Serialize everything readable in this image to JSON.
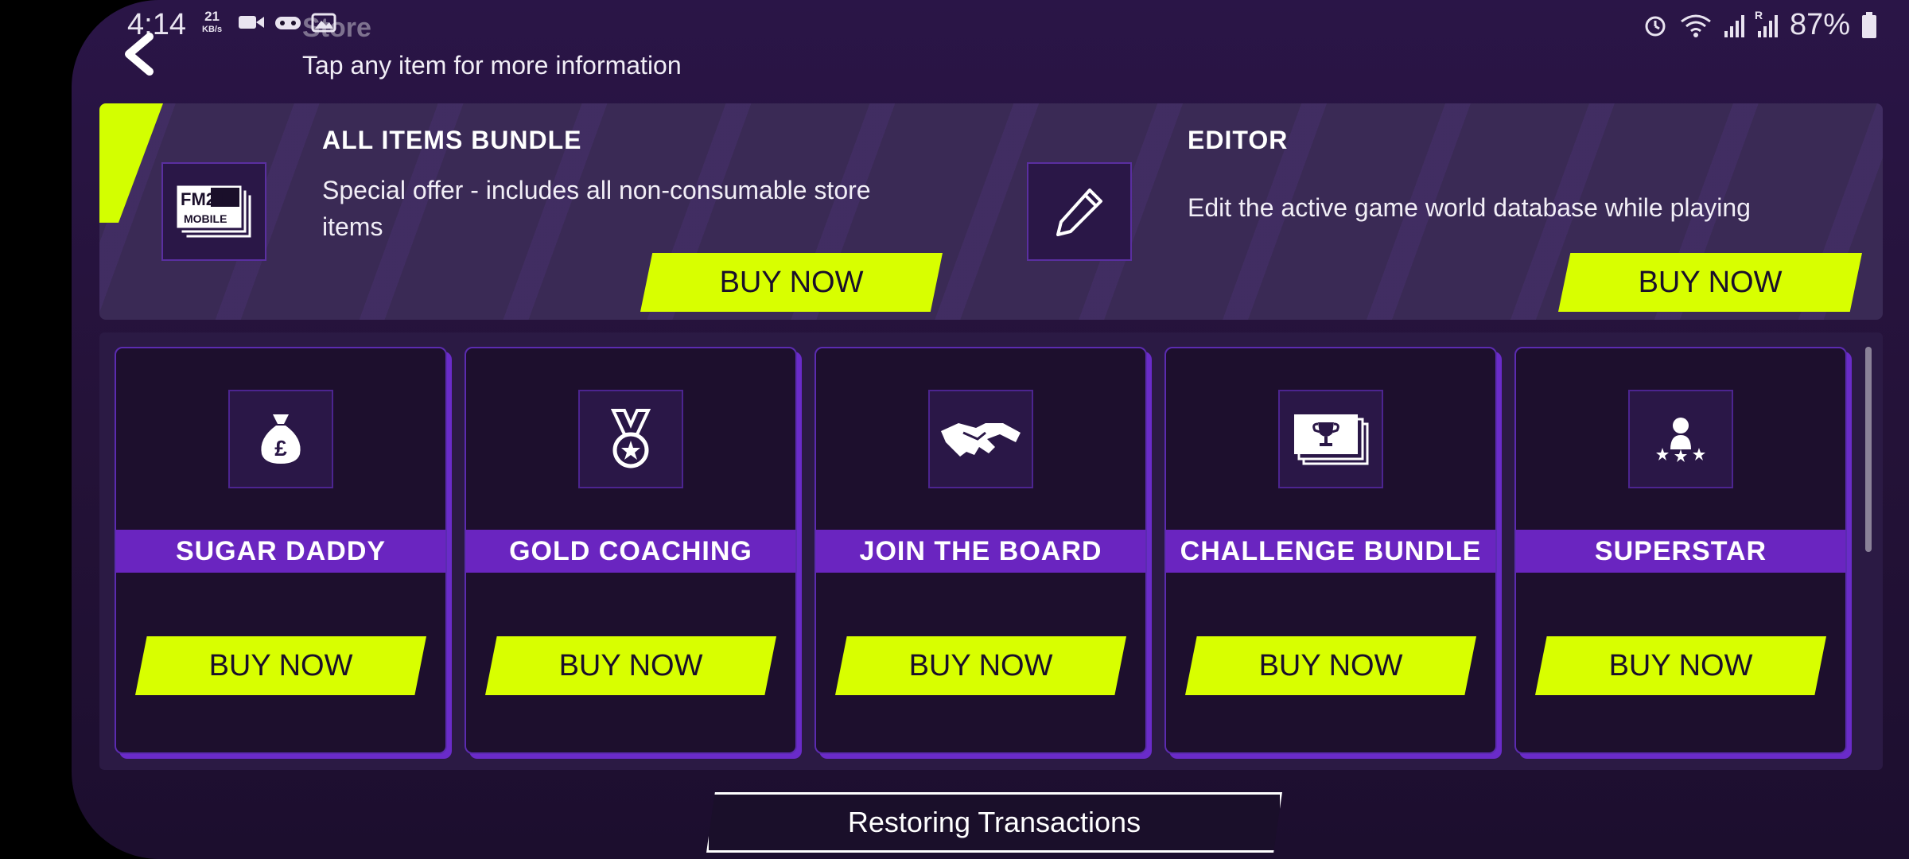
{
  "status_bar": {
    "time": "4:14",
    "net_speed_value": "21",
    "net_speed_unit": "KB/s",
    "signal_tag": "R",
    "battery": "87%",
    "icons": [
      "video-icon",
      "game-icon",
      "image-icon",
      "alarm-icon",
      "wifi-icon",
      "signal-icon",
      "battery-icon"
    ]
  },
  "header": {
    "title": "Store",
    "hint": "Tap any item for more information"
  },
  "featured": [
    {
      "title": "ALL ITEMS BUNDLE",
      "description": "Special offer - includes all non-consumable store items",
      "icon": "fm21-mobile-logo",
      "logo_text_top": "FM21",
      "logo_text_bottom": "MOBILE",
      "button": "BUY NOW"
    },
    {
      "title": "EDITOR",
      "description": "Edit the active game world database while playing",
      "icon": "pencil-icon",
      "button": "BUY NOW"
    }
  ],
  "items": [
    {
      "title": "SUGAR DADDY",
      "icon": "money-bag-icon",
      "button": "BUY NOW"
    },
    {
      "title": "GOLD COACHING",
      "icon": "medal-icon",
      "button": "BUY NOW"
    },
    {
      "title": "JOIN THE BOARD",
      "icon": "handshake-icon",
      "button": "BUY NOW"
    },
    {
      "title": "CHALLENGE BUNDLE",
      "icon": "trophy-cards-icon",
      "button": "BUY NOW"
    },
    {
      "title": "SUPERSTAR",
      "icon": "superstar-icon",
      "button": "BUY NOW"
    }
  ],
  "footer": {
    "status_button": "Restoring Transactions"
  },
  "colors": {
    "accent": "#d8ff00",
    "band": "#6a25c0",
    "card_bg": "#1d0f2d",
    "panel_bg": "#3a2a55"
  }
}
